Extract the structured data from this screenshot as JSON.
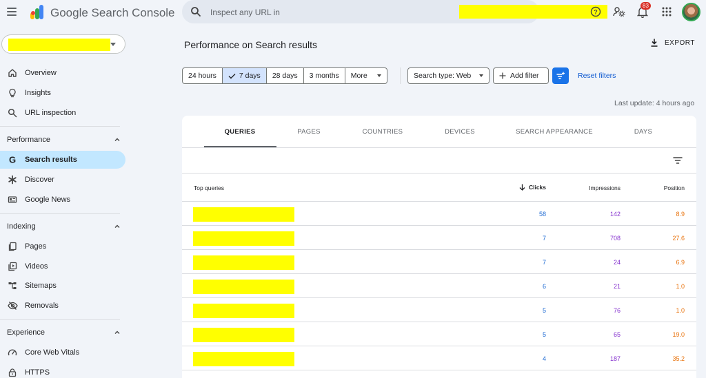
{
  "header": {
    "app_title": "Google Search Console",
    "search_placeholder": "Inspect any URL in",
    "notification_count": "83"
  },
  "sidebar": {
    "top_items": [
      {
        "label": "Overview",
        "icon": "home-icon"
      },
      {
        "label": "Insights",
        "icon": "lightbulb-icon"
      },
      {
        "label": "URL inspection",
        "icon": "search-icon"
      }
    ],
    "sections": [
      {
        "title": "Performance",
        "items": [
          {
            "label": "Search results",
            "icon": "google-g-icon",
            "active": true
          },
          {
            "label": "Discover",
            "icon": "asterisk-icon"
          },
          {
            "label": "Google News",
            "icon": "news-icon"
          }
        ]
      },
      {
        "title": "Indexing",
        "items": [
          {
            "label": "Pages",
            "icon": "pages-icon"
          },
          {
            "label": "Videos",
            "icon": "video-icon"
          },
          {
            "label": "Sitemaps",
            "icon": "sitemap-icon"
          },
          {
            "label": "Removals",
            "icon": "eye-off-icon"
          }
        ]
      },
      {
        "title": "Experience",
        "items": [
          {
            "label": "Core Web Vitals",
            "icon": "gauge-icon"
          },
          {
            "label": "HTTPS",
            "icon": "lock-icon"
          }
        ]
      }
    ]
  },
  "main": {
    "page_title": "Performance on Search results",
    "export_label": "EXPORT",
    "date_ranges": [
      "24 hours",
      "7 days",
      "28 days",
      "3 months",
      "More"
    ],
    "selected_range": "7 days",
    "search_type": "Search type: Web",
    "add_filter": "Add filter",
    "reset_filters": "Reset filters",
    "last_update": "Last update: 4 hours ago",
    "tabs": [
      "QUERIES",
      "PAGES",
      "COUNTRIES",
      "DEVICES",
      "SEARCH APPEARANCE",
      "DAYS"
    ],
    "active_tab": "QUERIES",
    "table": {
      "columns": [
        "Top queries",
        "Clicks",
        "Impressions",
        "Position"
      ],
      "rows": [
        {
          "clicks": "58",
          "impressions": "142",
          "position": "8.9"
        },
        {
          "clicks": "7",
          "impressions": "708",
          "position": "27.6"
        },
        {
          "clicks": "7",
          "impressions": "24",
          "position": "6.9"
        },
        {
          "clicks": "6",
          "impressions": "21",
          "position": "1.0"
        },
        {
          "clicks": "5",
          "impressions": "76",
          "position": "1.0"
        },
        {
          "clicks": "5",
          "impressions": "65",
          "position": "19.0"
        },
        {
          "clicks": "4",
          "impressions": "187",
          "position": "35.2"
        }
      ]
    }
  },
  "colors": {
    "clicks": "#1967d2",
    "impressions": "#8430ce",
    "position": "#e8710a",
    "accent": "#1a73e8",
    "active_nav": "#c2e7ff",
    "redaction": "#ffff00"
  }
}
